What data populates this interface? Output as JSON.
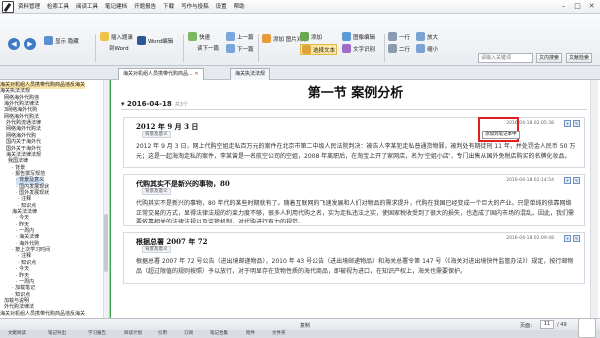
{
  "menu": [
    "资料管理",
    "检索工具",
    "阅读工具",
    "笔记建档",
    "开题报告",
    "下载",
    "写作与投稿",
    "设置",
    "帮助"
  ],
  "toolbar": {
    "show_hide": "显示\n隐藏",
    "insert_problem": "插入题录",
    "to_word": "到Word",
    "word_edit": "Word编辑",
    "quick": "快速",
    "read_next": "读下一篇",
    "prev": "上一篇",
    "next": "下一篇",
    "add_image": "添加\n图片对象",
    "add_table": "添加",
    "select_text": "选择文本",
    "image_edit": "图像编辑",
    "text_recog": "文字识别",
    "one_line": "一行",
    "two_lines": "二行",
    "zoom_in": "放大",
    "zoom_out": "缩小",
    "search_placeholder": "请输入关键词",
    "search_btn": "文内搜索",
    "prev_btn": "文献检索"
  },
  "tabs": [
    "海关对机组人员携带代购商品...",
    "海关执法法规"
  ],
  "sidebar": [
    "海关对机组人员携带代购商品违反海关",
    "海关执法法规",
    "网络海外代购违",
    "海外代购法律法",
    "3网络海外代购",
    "网络海外代购法",
    "外代购流通法律",
    "网络海外代购法",
    "网络海外代购",
    "国内关于海外代",
    "国外关于海外代",
    "海关法法律法规",
    "我国法律",
    "· 背景",
    "· 报告撰写规范",
    "· 背景及意义",
    "· 国内发展现状",
    "· 国外发展现状",
    "· 注释",
    "· 知识点",
    "海关法法律",
    "· 今天 ",
    "· 昨天",
    "· 一周内",
    "· 海关法律",
    "· 海外代购",
    "· 按上次学习时间",
    "· 注释",
    "· 知识点",
    "· 今天",
    "· 昨天",
    "· 一周内",
    "· 加载笔记",
    "· 知识点",
    "加载与说明",
    "外代购法律法",
    "海关对机组人员携带代购商品违反海关"
  ],
  "main": {
    "section_title": "第一节  案例分析",
    "date": "2016-04-18",
    "date_count": "共3个",
    "cards": [
      {
        "title": "2012 年 9 月 3 日",
        "tag": "背景及意义",
        "date": "2016-04-18 02:05:38",
        "body": "2012 年 9 月 3 日，网上代购空姐走私百万元的案件在北京市第二中级人民法院判决：被告人李某犯走私普通货物罪，被判处有期徒刑 11 年，并处罚金人民币 50 万元；这是一起海淘走私的案件，李某曾是一名航空公司的空姐，2008 年离职后，在淘宝上开了家网店，名为'空姐小店'，专门出售从国外免税店购买的名牌化妆品。"
      },
      {
        "title": "代购其实不是新兴的事物，80",
        "tag": "背景及意义",
        "date": "2016-04-18 02:14:54",
        "body": "代购其实不是新兴的事物，80 年代的某些时期就有了。随着互联网的飞速发展和人们对物品的需求提升，代购在我国已经变成一个巨大的产业。只是单纯的依靠网络正常交易的方式，显得法律法规的约束力度不够，很多人利用代购之名，实为走私违法之实，使国家税收受到了很大的损失，也造成了国内市场的混乱。因此，我们需要依靠相关的法律法规以及监管机制，对代购进行有力的规范。"
      },
      {
        "title": "根据总署 2007 年 72",
        "tag": "背景及意义",
        "date": "2016-04-18 02:09:48",
        "body": "根据总署 2007 年 72 号公告（进出境邮递物品），2010 年 43 号公告（进出境邮递物品）和海关总署令第 147 号（《海关对进出境快件监管办法》）规定，按行邮物品（超过限值的规则按照）予以放行，对于明显存在货物性质的海代商品，即被视为进口，在知识产权上，海关也需要保护。"
      }
    ],
    "tooltip": "添加到笔记本中"
  },
  "status": {
    "copy": "复制",
    "page_label": "页面：",
    "page_current": "11",
    "page_total": "/ 49"
  },
  "bottom_tabs": [
    "文献阅读",
    "笔记导出",
    "学习报告",
    "阅读计划",
    "引用",
    "订阅",
    "笔记合集",
    "附件",
    "文件夹"
  ],
  "colors": {
    "bg_green": "#3aa64a",
    "highlight_red": "#e02020",
    "accent_blue": "#2d5a9a"
  }
}
